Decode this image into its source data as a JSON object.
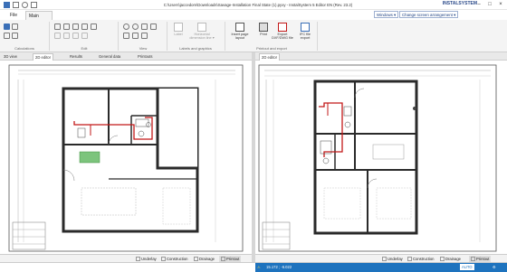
{
  "window": {
    "title": "C:\\Users\\jaccedom\\Downloads\\Savage-Installation Final State (1).pyxy - InstalSystem 5 Editor EN (Rev. 23.2)",
    "brand": "INSTALSYSTEM",
    "min_label": "–",
    "max_label": "□",
    "close_label": "×"
  },
  "tabs": {
    "file": "File",
    "main": "Main tools"
  },
  "top_right": {
    "windows_label": "Windows ▾",
    "arrangement_label": "Change screen arrangement ▾"
  },
  "ribbon": {
    "groups": {
      "calculations": "Calculations",
      "edit": "Edit",
      "view": "View",
      "labels": "Labels and graphics",
      "printout": "Printout and export"
    },
    "buttons": {
      "label": "Label",
      "horizontal": "Horizontal dimension line ▾",
      "insert_page": "Insert page layout",
      "print": "Print",
      "export_dxf": "Export DXF/DWG file",
      "ifc_export": "IFC file export"
    }
  },
  "view_tabs": [
    {
      "label": "3D view"
    },
    {
      "label": "2D editor",
      "active": true
    },
    {
      "label": "Results"
    },
    {
      "label": "General data"
    },
    {
      "label": "Printouts"
    },
    {
      "label": "2D editor",
      "active": true
    }
  ],
  "bottom_tabs": {
    "underlay": "Underlay",
    "construction": "Construction",
    "drainage": "Drainage",
    "printout": "Printout"
  },
  "status": {
    "coords": "15.172 ; -6.022",
    "snap": "AUTO",
    "accent": "#1e73be"
  },
  "colors": {
    "wall": "#2a2a2a",
    "pipe": "#c21818",
    "room_green": "#7cc47c"
  }
}
